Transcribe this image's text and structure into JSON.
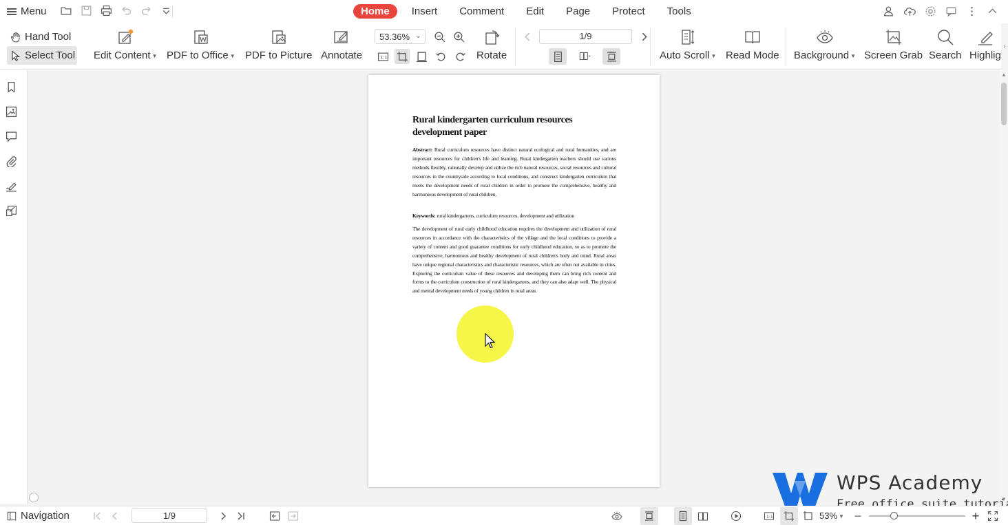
{
  "topbar": {
    "menu_label": "Menu",
    "tabs": [
      {
        "label": "Home",
        "active": true
      },
      {
        "label": "Insert"
      },
      {
        "label": "Comment"
      },
      {
        "label": "Edit"
      },
      {
        "label": "Page"
      },
      {
        "label": "Protect"
      },
      {
        "label": "Tools"
      }
    ]
  },
  "ribbon": {
    "hand_tool": "Hand Tool",
    "select_tool": "Select Tool",
    "edit_content": "Edit Content",
    "pdf_to_office": "PDF to Office",
    "pdf_to_picture": "PDF to Picture",
    "annotate": "Annotate",
    "zoom_value": "53.36%",
    "rotate": "Rotate",
    "page_value": "1/9",
    "auto_scroll": "Auto Scroll",
    "read_mode": "Read Mode",
    "background": "Background",
    "screen_grab": "Screen Grab",
    "search": "Search",
    "highlight": "Highlig"
  },
  "document": {
    "title": "Rural kindergarten curriculum resources development paper",
    "abstract_label": "Abstract:",
    "abstract_text": "Rural curriculum resources have distinct natural ecological and rural humanities, and are important resources for children's life and learning. Rural kindergarten teachers should use various methods flexibly, rationally develop and utilize the rich natural resources, social resources and cultural resources in the countryside according to local conditions, and construct kindergarten curriculum that meets the development needs of rural children in order to promote the comprehensive, healthy and harmonious development of rural children.",
    "keywords_label": "Keywords:",
    "keywords_text": "rural kindergartens, curriculum resources, development and utilization",
    "body_text": "The development of rural early childhood education requires the development and utilization of rural resources in accordance with the characteristics of the village and the local conditions to provide a variety of content and good guarantee conditions for early childhood education, so as to promote the comprehensive, harmonious and healthy development of rural children's body and mind. Rural areas have unique regional characteristics and characteristic resources, which are often not available in cities. Exploring the curriculum value of these resources and developing them can bring rich content and forms to the curriculum construction of rural kindergartens, and they can also adapt well. The physical and mental development needs of young children in rural areas."
  },
  "watermark": {
    "title": "WPS Academy",
    "subtitle": "Free office suite tutorials"
  },
  "statusbar": {
    "navigation": "Navigation",
    "page_value": "1/9",
    "zoom": "53%"
  },
  "colors": {
    "accent": "#e8453c",
    "cursor_highlight": "#f5f528",
    "logo_blue": "#1a6fe0"
  }
}
